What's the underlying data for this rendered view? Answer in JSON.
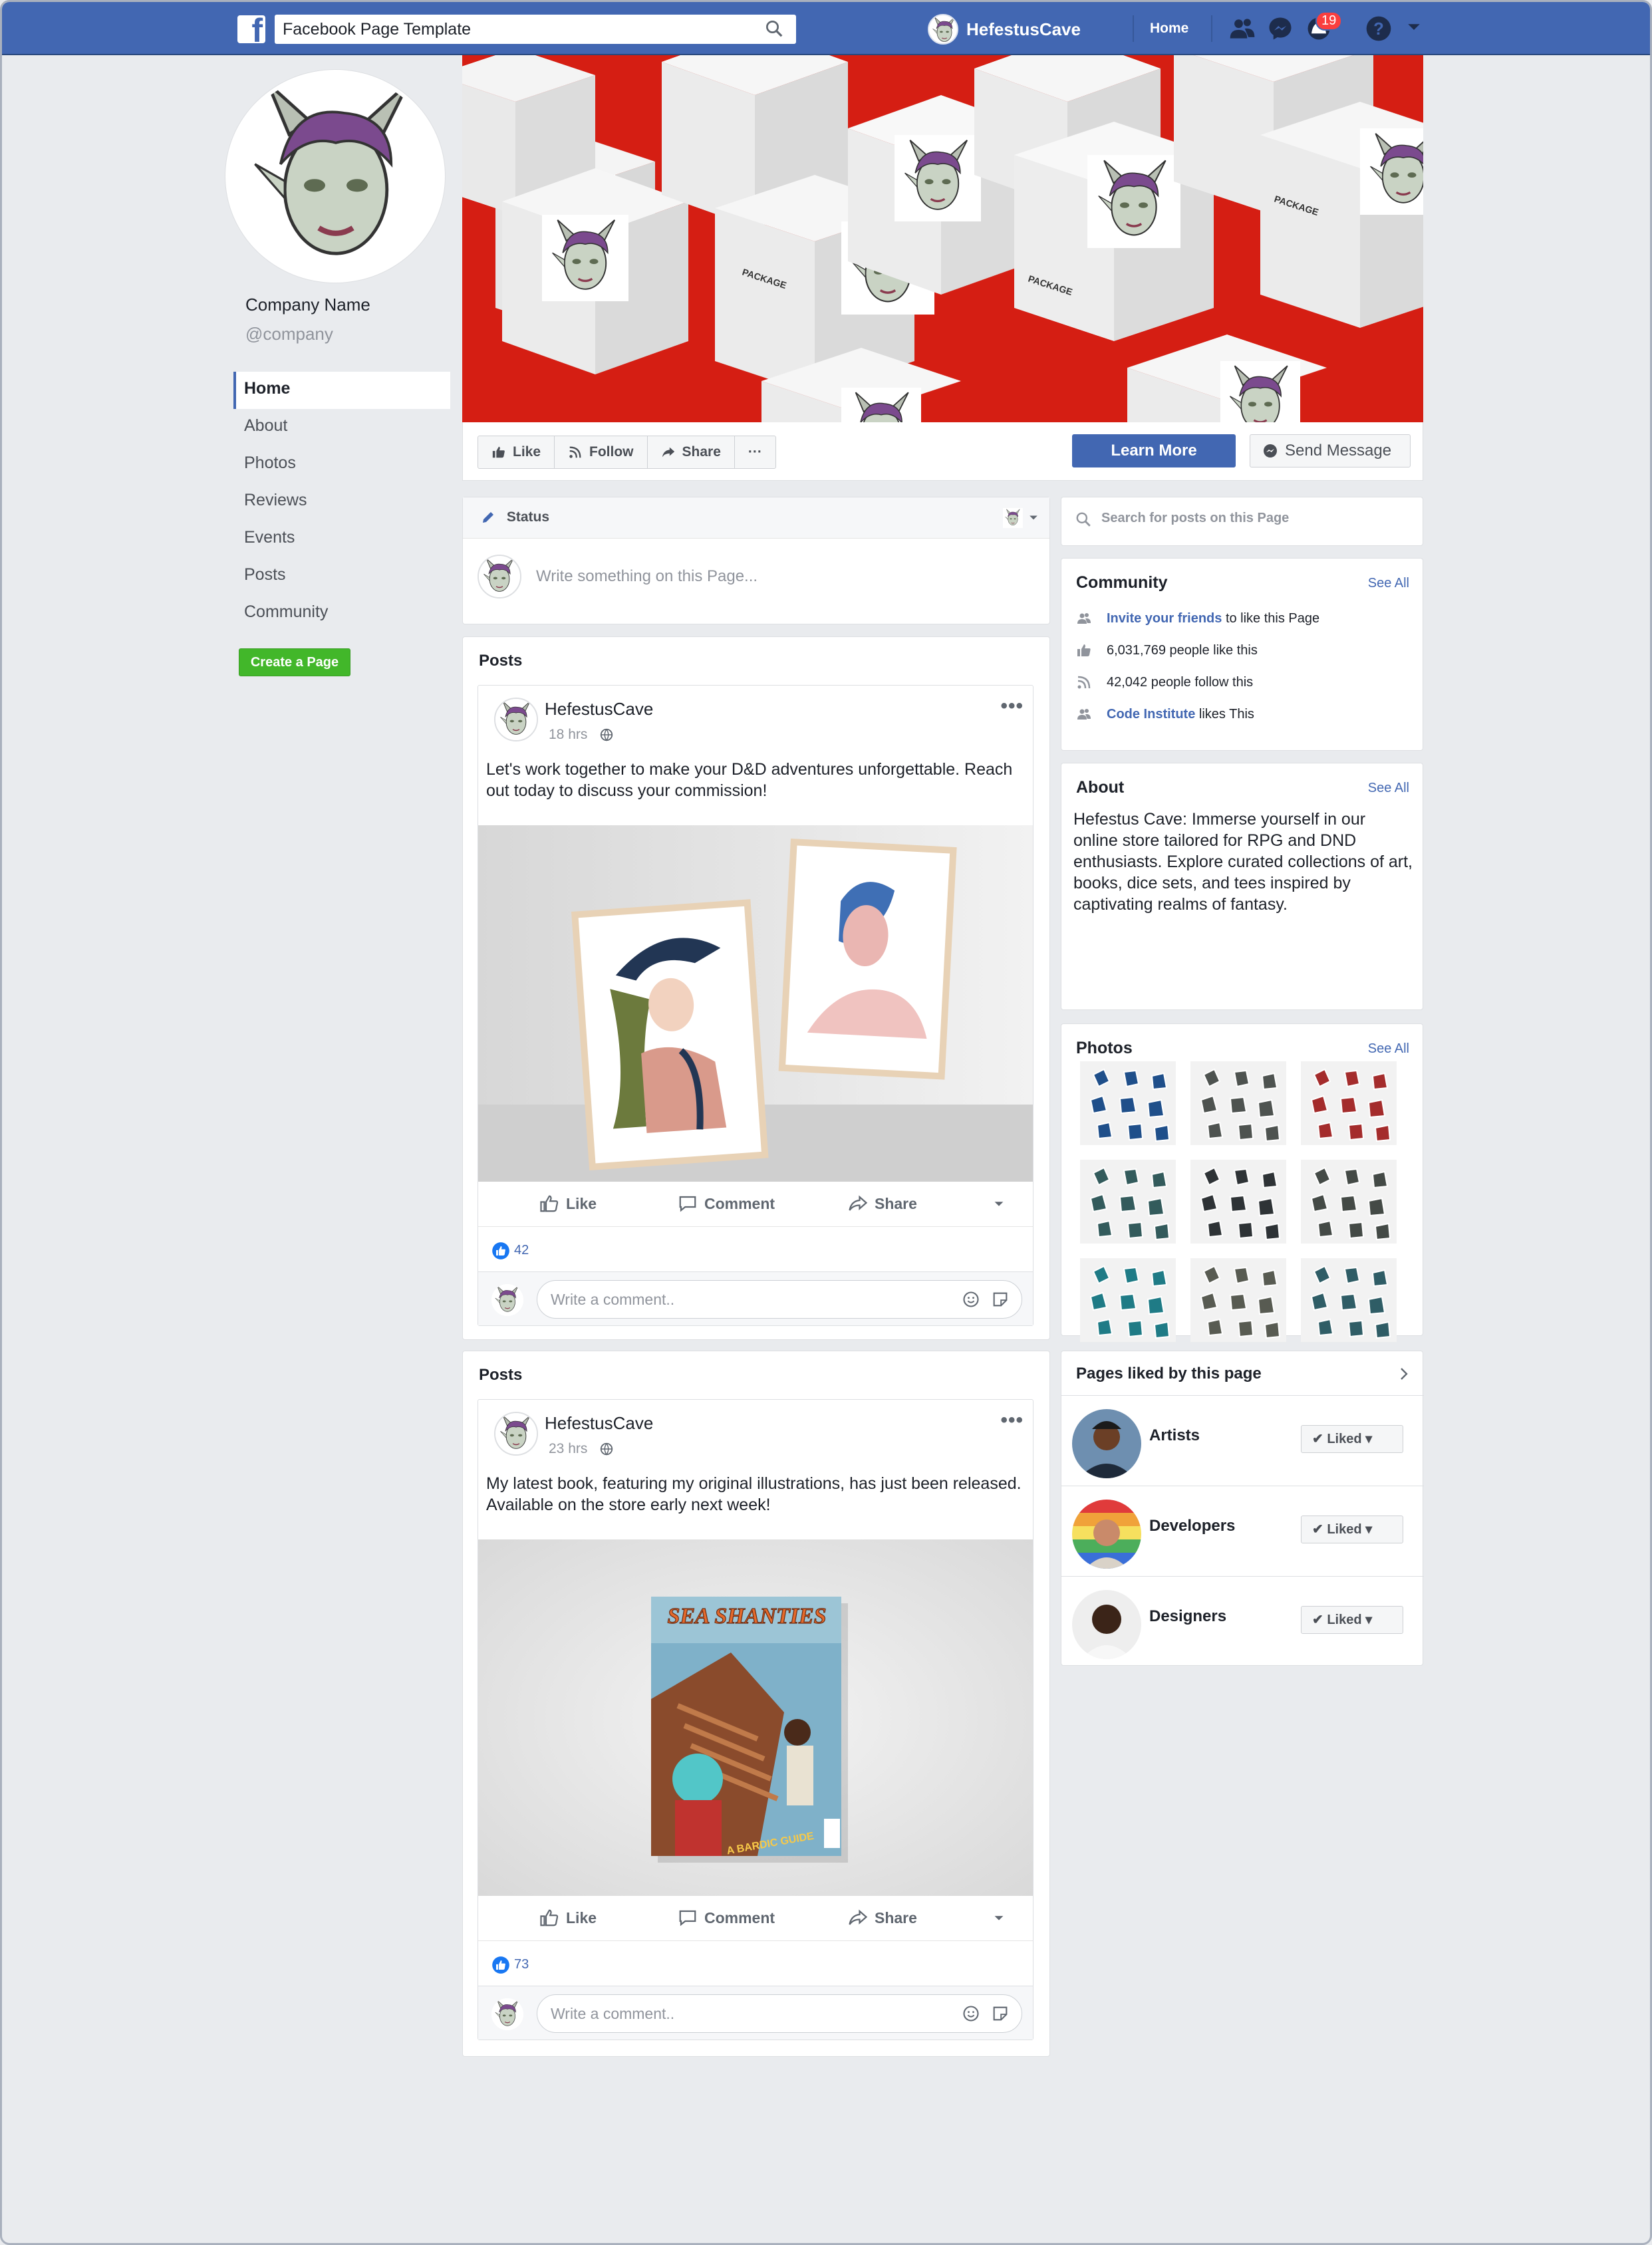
{
  "topbar": {
    "search_value": "Facebook Page Template",
    "page_name": "HefestusCave",
    "home_label": "Home",
    "notifications_count": "19"
  },
  "page": {
    "company_name": "Company Name",
    "handle": "@company",
    "nav": [
      "Home",
      "About",
      "Photos",
      "Reviews",
      "Events",
      "Posts",
      "Community"
    ],
    "create_page_label": "Create a Page"
  },
  "actionbar": {
    "like": "Like",
    "follow": "Follow",
    "share": "Share",
    "more": "···",
    "learn_more": "Learn More",
    "send_message": "Send Message"
  },
  "cover": {
    "box_label": "PACKAGE"
  },
  "composer": {
    "tab": "Status",
    "placeholder": "Write something on this Page..."
  },
  "posts": [
    {
      "section_title": "Posts",
      "author": "HefestusCave",
      "time": "18 hrs",
      "text": "Let's work together to make your D&D adventures unforgettable. Reach out today to discuss your commission!",
      "like": "Like",
      "comment": "Comment",
      "share": "Share",
      "reactions": "42",
      "comment_placeholder": "Write a comment.."
    },
    {
      "section_title": "Posts",
      "author": "HefestusCave",
      "time": "23 hrs",
      "text": "My latest book, featuring my original illustrations, has just been released. Available on the store early next week!",
      "like": "Like",
      "comment": "Comment",
      "share": "Share",
      "reactions": "73",
      "comment_placeholder": "Write a comment..",
      "book_title": "SEA SHANTIES",
      "book_subtitle": "A BARDIC GUIDE"
    }
  ],
  "sidebar": {
    "search_placeholder": "Search for posts on this Page",
    "community": {
      "title": "Community",
      "see_all": "See All",
      "invite_link": "Invite your friends",
      "invite_rest": "to like this Page",
      "likes": "6,031,769 people like this",
      "follows": "42,042 people follow this",
      "liker_link": "Code Institute",
      "liker_rest": "likes This"
    },
    "about": {
      "title": "About",
      "see_all": "See All",
      "text": "Hefestus Cave: Immerse yourself in our online store tailored for RPG and DND enthusiasts. Explore curated collections of art, books, dice sets, and tees inspired by captivating realms of fantasy."
    },
    "photos": {
      "title": "Photos",
      "see_all": "See All"
    },
    "pages_liked": {
      "title": "Pages liked by this page",
      "items": [
        {
          "name": "Artists",
          "button": "Liked"
        },
        {
          "name": "Developers",
          "button": "Liked"
        },
        {
          "name": "Designers",
          "button": "Liked"
        }
      ]
    }
  },
  "colors": {
    "brand": "#4267b2",
    "cover_red": "#d51e13",
    "create_green": "#42b72a"
  }
}
